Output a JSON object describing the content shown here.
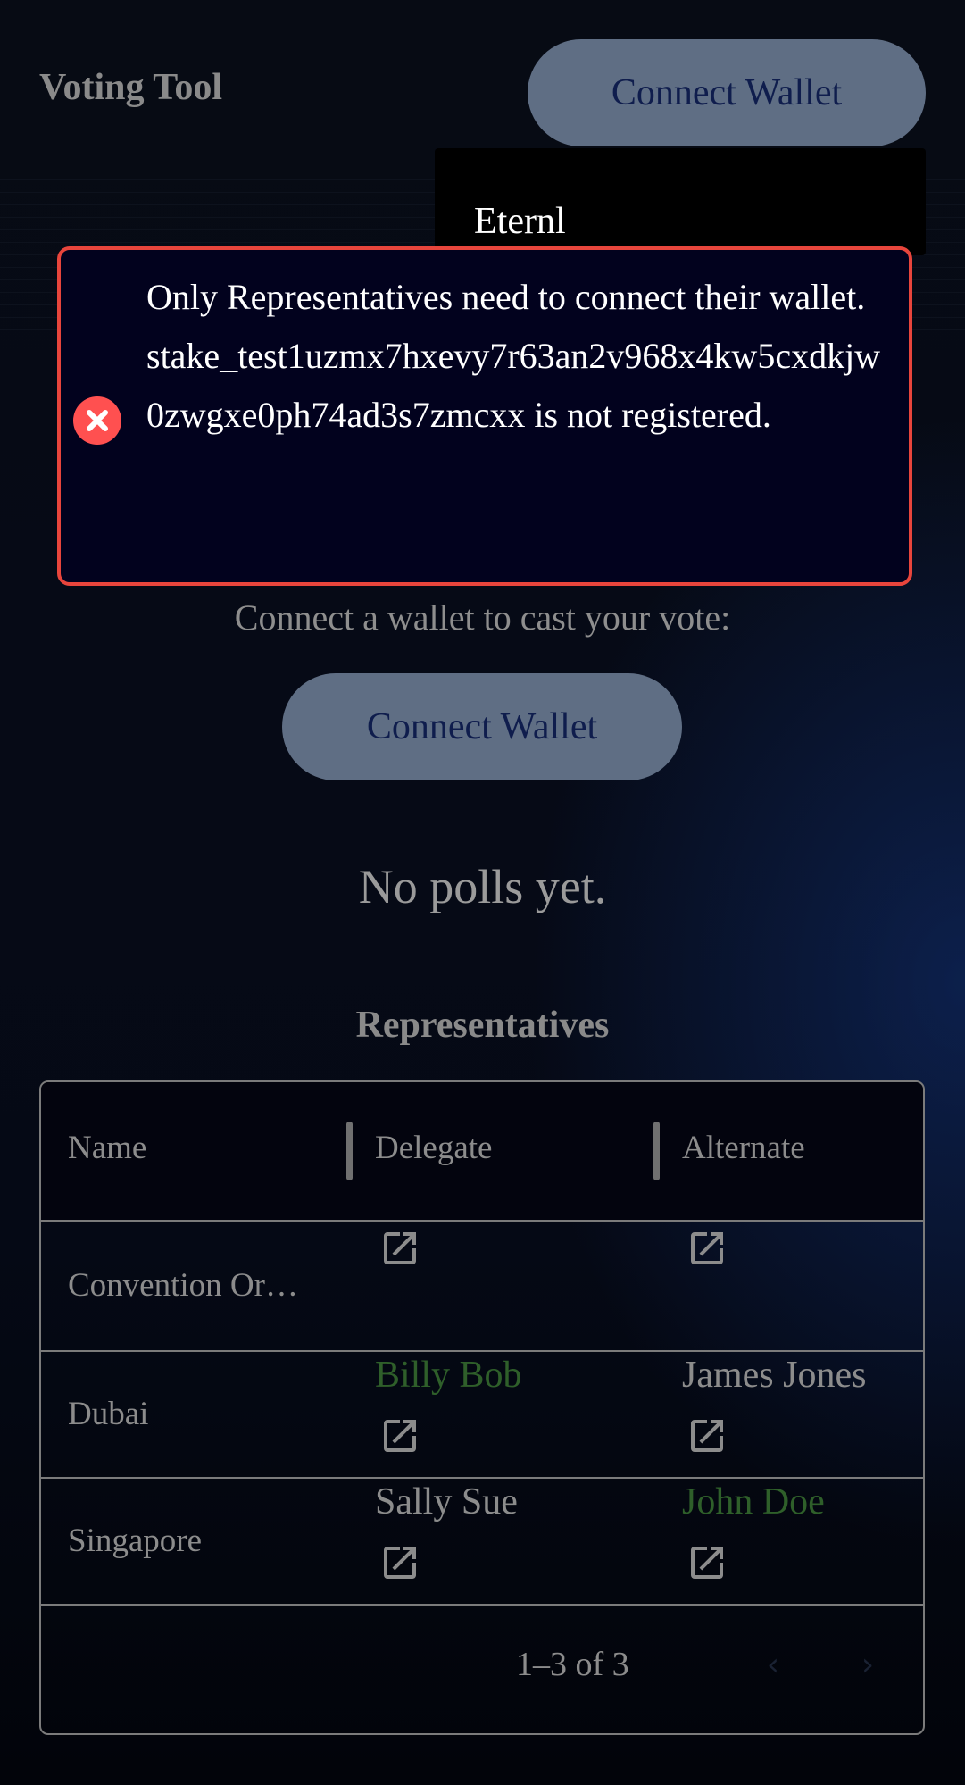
{
  "header": {
    "title": "Voting Tool",
    "connect_wallet_label": "Connect Wallet"
  },
  "wallet_menu": {
    "items": [
      {
        "label": "Eternl"
      }
    ]
  },
  "alert": {
    "type": "error",
    "icon": "error-x-icon",
    "message": "Only Representatives need to connect their wallet. stake_test1uzmx7hxevy7r63an2v968x4kw5cxdkjw0zwgxe0ph74ad3s7zmcxx is not registered."
  },
  "main": {
    "prompt": "Connect a wallet to cast your vote:",
    "connect_wallet_label": "Connect Wallet",
    "no_polls": "No polls yet."
  },
  "representatives": {
    "title": "Representatives",
    "columns": [
      "Name",
      "Delegate",
      "Alternate"
    ],
    "rows": [
      {
        "name": "Convention Or…",
        "delegate": "",
        "alternate": ""
      },
      {
        "name": "Dubai",
        "delegate": "Billy Bob",
        "alternate": "James Jones"
      },
      {
        "name": "Singapore",
        "delegate": "Sally Sue",
        "alternate": "John Doe"
      }
    ],
    "pagination": "1–3 of 3"
  },
  "colors": {
    "button_bg": "#5f6e84",
    "button_text": "#0f1d4d",
    "alert_border": "#e8453c",
    "active_person": "#2f5f2a"
  }
}
